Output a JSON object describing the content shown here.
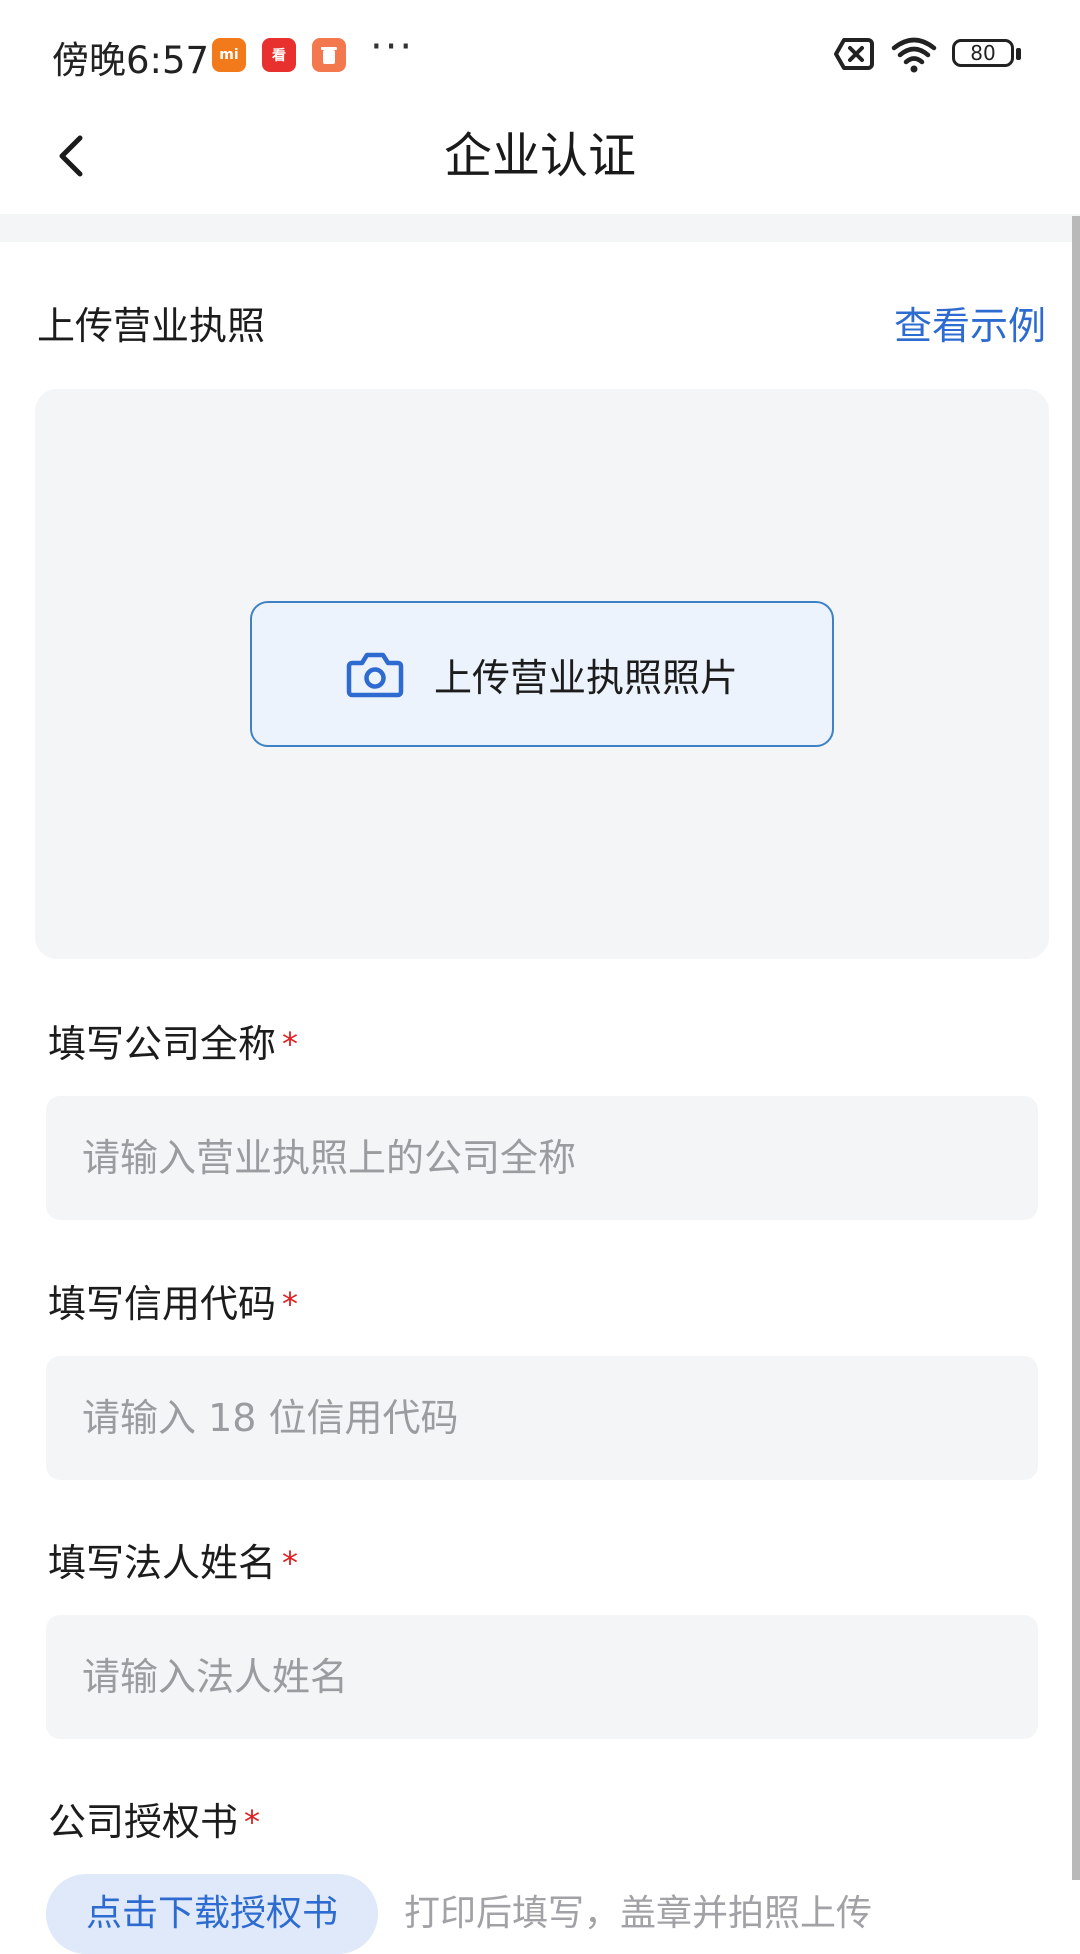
{
  "status_bar": {
    "time": "傍晚6:57",
    "battery": "80",
    "app_icons": [
      "mi-app-icon",
      "kandian-app-icon",
      "trash-app-icon"
    ]
  },
  "nav": {
    "title": "企业认证"
  },
  "license": {
    "title": "上传营业执照",
    "example_link": "查看示例",
    "upload_button": "上传营业执照照片"
  },
  "company_name": {
    "label": "填写公司全称",
    "required": "*",
    "placeholder": "请输入营业执照上的公司全称",
    "value": ""
  },
  "credit_code": {
    "label": "填写信用代码",
    "required": "*",
    "placeholder": "请输入 18 位信用代码",
    "value": ""
  },
  "legal_person": {
    "label": "填写法人姓名",
    "required": "*",
    "placeholder": "请输入法人姓名",
    "value": ""
  },
  "authorization": {
    "label": "公司授权书",
    "required": "*",
    "download_button": "点击下载授权书",
    "hint": "打印后填写，盖章并拍照上传"
  },
  "colors": {
    "accent": "#2e6bd0",
    "required": "#e02020",
    "input_bg": "#f4f5f7"
  }
}
